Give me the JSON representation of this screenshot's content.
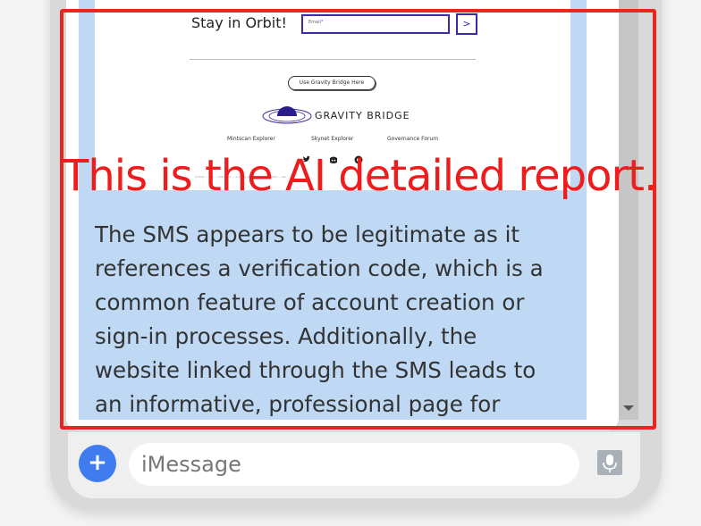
{
  "webpage": {
    "newsletter_label": "Stay in Orbit!",
    "email_placeholder": "Email*",
    "submit_glyph": ">",
    "bridge_button": "Use Gravity Bridge Here",
    "logo_text": "GRAVITY BRIDGE",
    "footer_links": [
      "Mintscan Explorer",
      "Skynet Explorer",
      "Governance Forum"
    ],
    "social_icons": [
      "twitter-icon",
      "discord-icon",
      "github-icon"
    ],
    "legal_text": "©2022 ... site ... Interchain ... is being used ... ever ... ©2022 ... ets ..."
  },
  "report": {
    "overlay_caption": "This is the AI detailed report.",
    "body": "The SMS appears to be legitimate as it references a verification code, which is a common feature of account creation or sign-in processes. Additionally, the website linked through the SMS leads to an informative, professional page for"
  },
  "composer": {
    "plus_label": "+",
    "input_placeholder": "iMessage",
    "mic_icon": "microphone-icon"
  },
  "colors": {
    "highlight_frame": "#e8261d",
    "bubble": "#bfd8f3",
    "send_accent": "#3f7cf0"
  }
}
